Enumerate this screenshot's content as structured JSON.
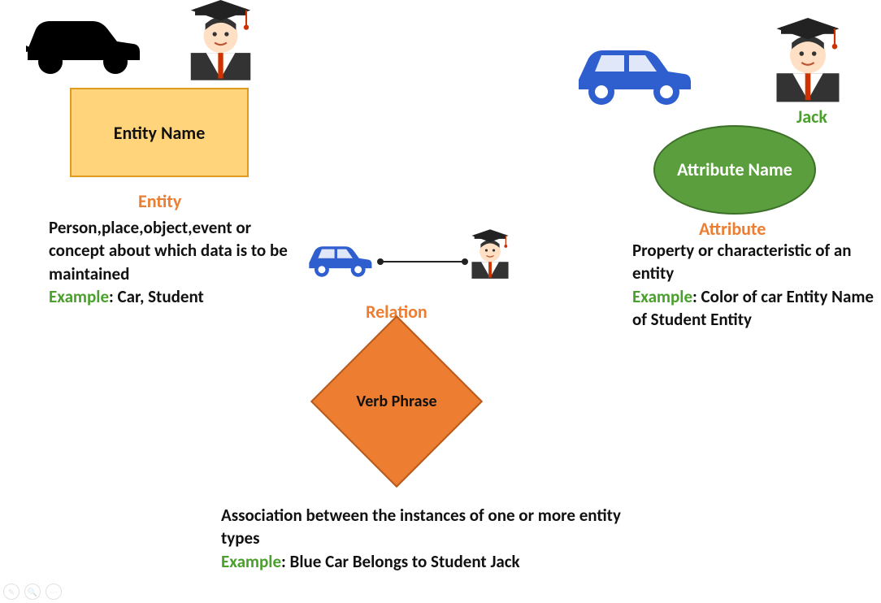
{
  "entity": {
    "box_label": "Entity Name",
    "heading": "Entity",
    "description": "Person,place,object,event or concept about which data is to be maintained",
    "example_label": "Example",
    "example_text": ": Car, Student"
  },
  "attribute": {
    "ellipse_label": "Attribute Name",
    "heading": "Attribute",
    "jack_label": "Jack",
    "description": "Property or characteristic of an entity",
    "example_label": "Example",
    "example_text": ": Color of car Entity Name of Student Entity"
  },
  "relation": {
    "diamond_label": "Verb Phrase",
    "heading": "Relation",
    "description": "Association between the instances of one or more entity types",
    "example_label": "Example",
    "example_text": ": Blue Car Belongs to Student Jack"
  },
  "icons": {
    "black_car": "black-car",
    "blue_car": "blue-car",
    "student": "student-graduate"
  }
}
